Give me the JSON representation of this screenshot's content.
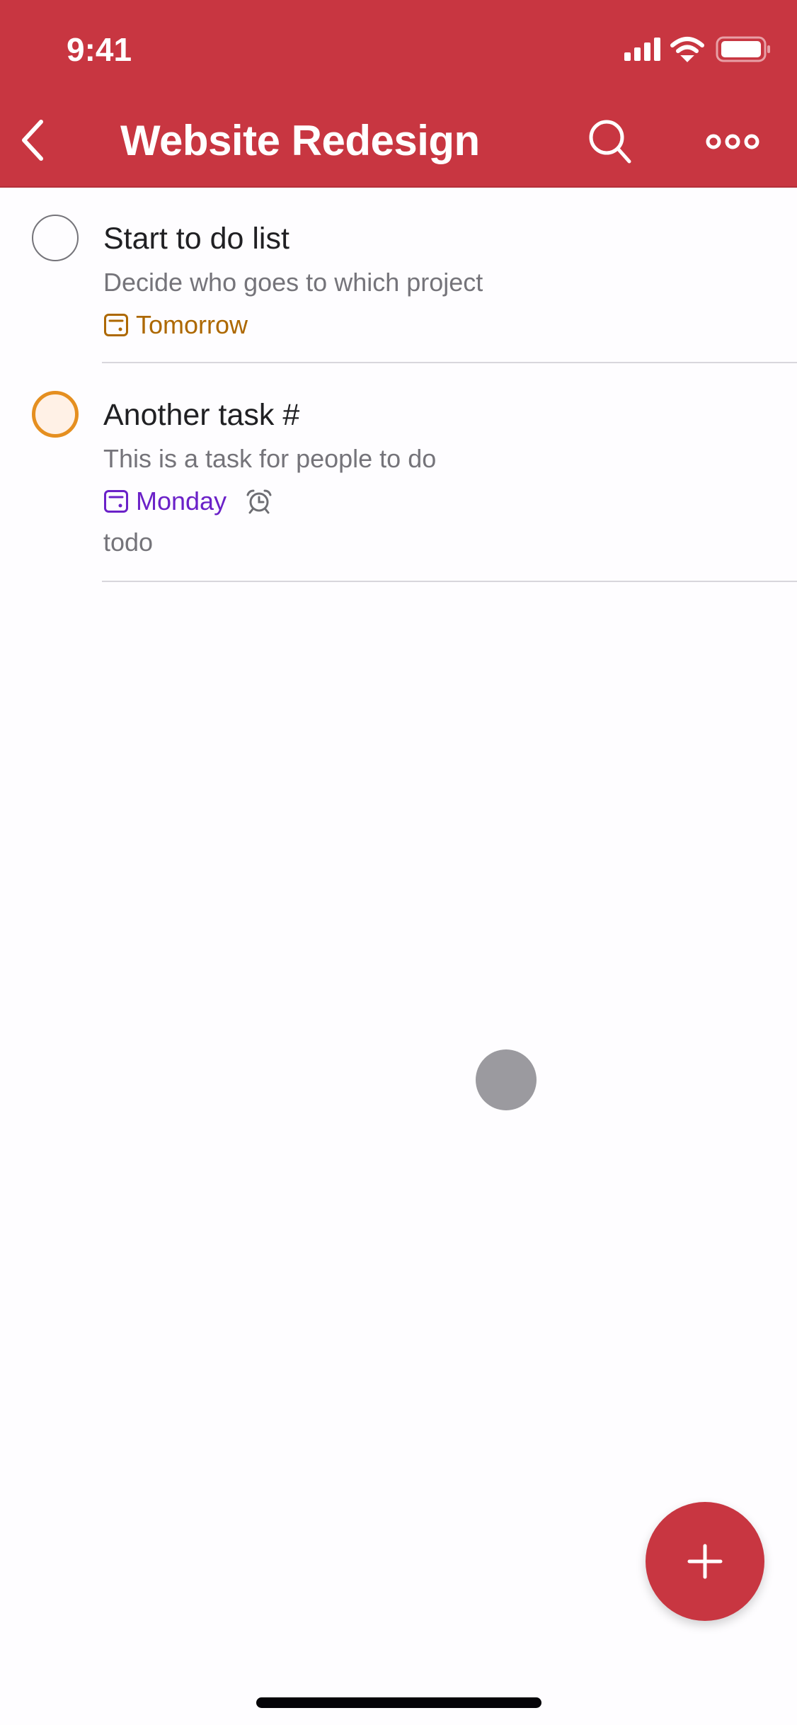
{
  "status_bar": {
    "time": "9:41",
    "icons": [
      "cellular-signal-icon",
      "wifi-icon",
      "battery-icon"
    ]
  },
  "header": {
    "title": "Website Redesign",
    "back_icon": "chevron-left-icon",
    "search_icon": "search-icon",
    "more_icon": "more-horizontal-icon",
    "background_color": "#c83641"
  },
  "tasks": [
    {
      "title": "Start to do list",
      "description": "Decide who goes to which project",
      "due": "Tomorrow",
      "due_color": "#ad6800",
      "priority_ring_color": "#75747a",
      "has_reminder": false,
      "label": ""
    },
    {
      "title": "Another task #",
      "description": "This is a task for people to do",
      "due": "Monday",
      "due_color": "#6b21c8",
      "priority_ring_color": "#e58f20",
      "has_reminder": true,
      "label": "todo"
    }
  ],
  "fab": {
    "icon": "plus-icon",
    "color": "#c83641"
  }
}
